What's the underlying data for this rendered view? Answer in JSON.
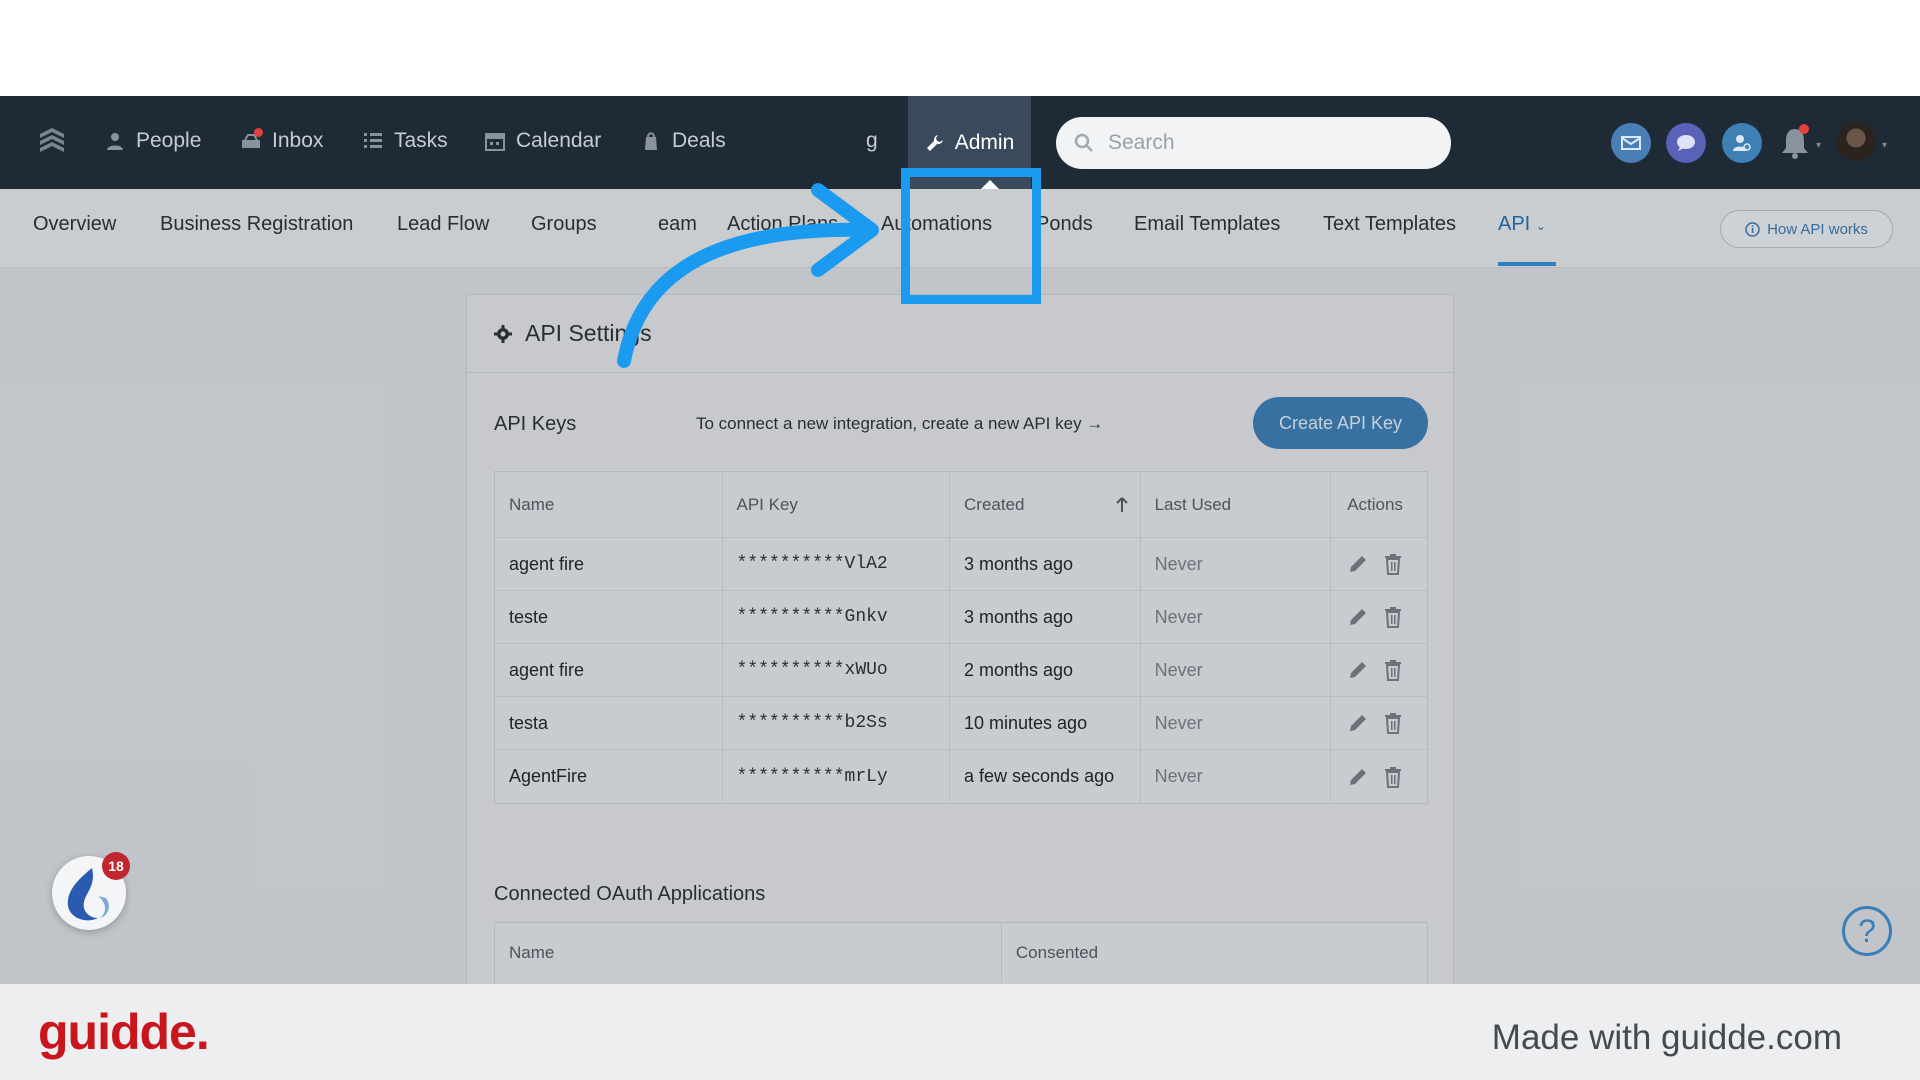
{
  "topnav": {
    "items": [
      {
        "label": "People",
        "icon": "person-icon"
      },
      {
        "label": "Inbox",
        "icon": "inbox-icon"
      },
      {
        "label": "Tasks",
        "icon": "list-icon"
      },
      {
        "label": "Calendar",
        "icon": "calendar-icon"
      },
      {
        "label": "Deals",
        "icon": "deals-icon"
      },
      {
        "label": "g",
        "icon": ""
      }
    ],
    "admin_label": "Admin",
    "search_placeholder": "Search"
  },
  "subnav": {
    "items": [
      "Overview",
      "Business Registration",
      "Lead Flow",
      "Groups",
      "eam",
      "Action Plans",
      "Automations",
      "Ponds",
      "Email Templates",
      "Text Templates",
      "API"
    ],
    "active": "API",
    "how_api": "How API works"
  },
  "card": {
    "title": "API Settings",
    "api_keys_title": "API Keys",
    "hint": "To connect a new integration, create a new API key →",
    "create_button": "Create API Key",
    "columns": [
      "Name",
      "API Key",
      "Created",
      "Last Used",
      "Actions"
    ],
    "rows": [
      {
        "name": "agent fire",
        "key": "**********VlA2",
        "created": "3 months ago",
        "last_used": "Never"
      },
      {
        "name": "teste",
        "key": "**********Gnkv",
        "created": "3 months ago",
        "last_used": "Never"
      },
      {
        "name": "agent fire",
        "key": "**********xWUo",
        "created": "2 months ago",
        "last_used": "Never"
      },
      {
        "name": "testa",
        "key": "**********b2Ss",
        "created": "10 minutes ago",
        "last_used": "Never"
      },
      {
        "name": "AgentFire",
        "key": "**********mrLy",
        "created": "a few seconds ago",
        "last_used": "Never"
      }
    ],
    "oauth_title": "Connected OAuth Applications",
    "oauth_columns": [
      "Name",
      "Consented"
    ]
  },
  "widgets": {
    "fire_badge": "18",
    "help": "?"
  },
  "footer": {
    "brand": "guidde.",
    "made_with": "Made with guidde.com"
  },
  "colors": {
    "nav_bg": "#1e2a36",
    "accent": "#1a9bf0",
    "button": "#3a7fb8",
    "brand": "#c9161d"
  }
}
